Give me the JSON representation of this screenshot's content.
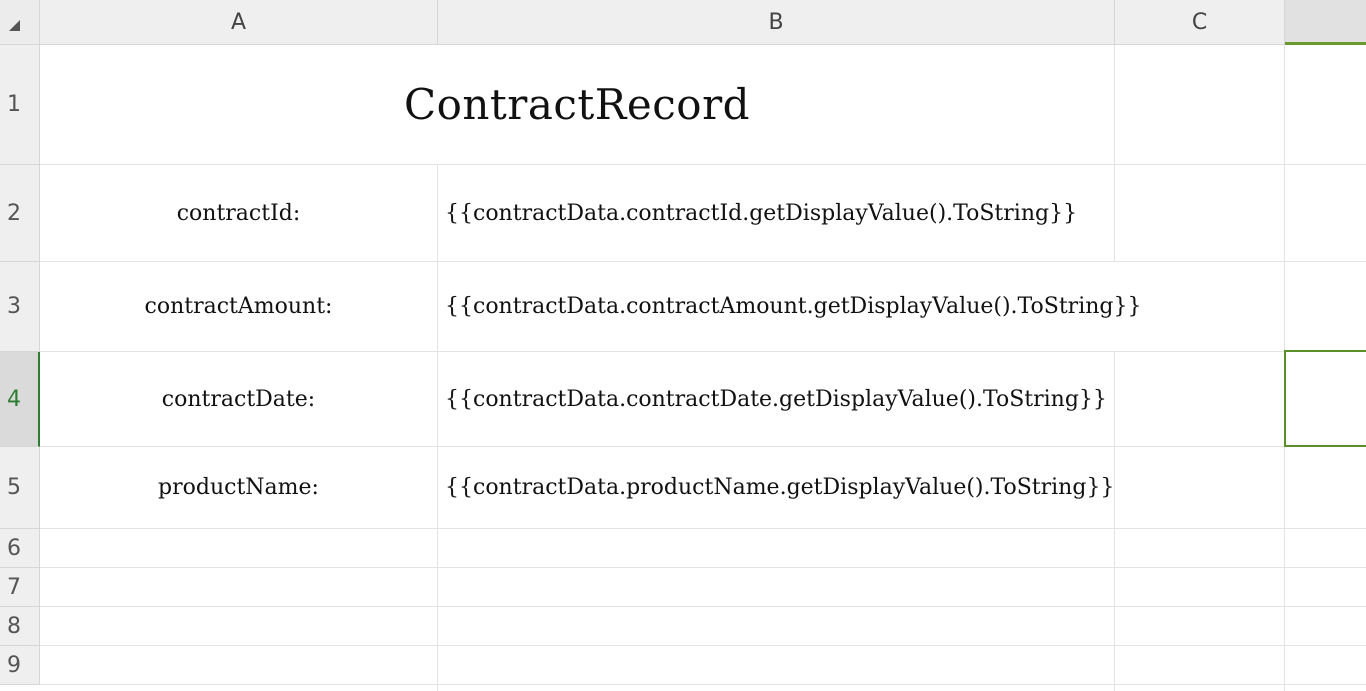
{
  "columns": [
    {
      "id": "A",
      "label": "A"
    },
    {
      "id": "B",
      "label": "B"
    },
    {
      "id": "C",
      "label": "C"
    },
    {
      "id": "D",
      "label": ""
    }
  ],
  "rows": [
    {
      "label": "1"
    },
    {
      "label": "2"
    },
    {
      "label": "3"
    },
    {
      "label": "4"
    },
    {
      "label": "5"
    },
    {
      "label": "6"
    },
    {
      "label": "7"
    },
    {
      "label": "8"
    },
    {
      "label": "9"
    }
  ],
  "cells": {
    "title": "ContractRecord",
    "r2_label": "contractId:",
    "r2_value": "{{contractData.contractId.getDisplayValue().ToString}}",
    "r3_label": "contractAmount:",
    "r3_value": "{{contractData.contractAmount.getDisplayValue().ToString}}",
    "r4_label": "contractDate:",
    "r4_value": "{{contractData.contractDate.getDisplayValue().ToString}}",
    "r5_label": "productName:",
    "r5_value": "{{contractData.productName.getDisplayValue().ToString}}"
  },
  "selection": {
    "active_row": "4"
  },
  "colors": {
    "selection": "#5a8f29",
    "active_header_text": "#2e7d32"
  }
}
